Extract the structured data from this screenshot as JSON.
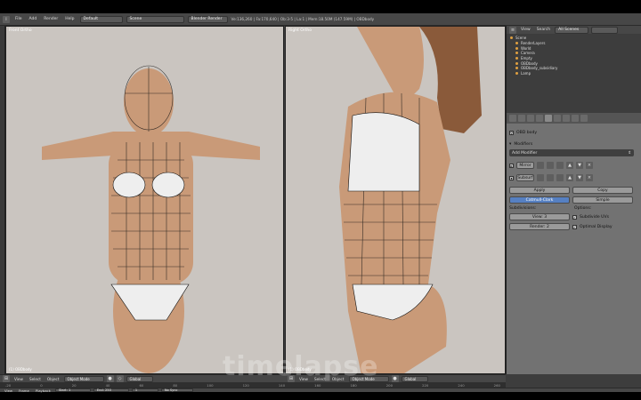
{
  "topbar": {
    "menus": [
      "File",
      "Add",
      "Render",
      "Help"
    ],
    "layout": "Default",
    "scene": "Scene",
    "engine": "Blender Render",
    "stats": "Ve:136,260 | Fa:170,640 | Ob:3-5 | La:1 | Mem:18.50M (147.59M) | OBDbody"
  },
  "viewports": {
    "front": {
      "label": "Front Ortho",
      "footer": "(1) OBDbody"
    },
    "right": {
      "label": "Right Ortho",
      "footer": "(1) OBDbody"
    }
  },
  "view_header": {
    "menus": [
      "View",
      "Select",
      "Object"
    ],
    "mode": "Object Mode",
    "orient": "Global"
  },
  "outliner": {
    "view": "View",
    "search": "Search",
    "filter": "All Scenes",
    "items": [
      "Scene",
      "RenderLayers",
      "World",
      "Camera",
      "Empty",
      "OBDbody",
      "OBDbody_subsidiary",
      "Lamp"
    ]
  },
  "properties": {
    "object_name": "OBD body",
    "section": "Modifiers",
    "add_modifier": "Add Modifier",
    "mod1": "Mirror",
    "mod2": "Subsurf",
    "apply": "Apply",
    "copy": "Copy",
    "type_cc": "Catmull-Clark",
    "type_simple": "Simple",
    "subdiv_label": "Subdivisions:",
    "options_label": "Options:",
    "view_label": "View: 3",
    "render_label": "Render: 2",
    "opt1": "Subdivide UVs",
    "opt2": "Optimal Display"
  },
  "timeline": {
    "ticks": [
      "-20",
      "0",
      "20",
      "40",
      "60",
      "80",
      "100",
      "120",
      "140",
      "160",
      "180",
      "200",
      "220",
      "240",
      "260"
    ],
    "menus": [
      "View",
      "Frame",
      "Playback"
    ],
    "start": "Start: 1",
    "end": "End: 250",
    "frame": "1",
    "sync": "No Sync"
  },
  "watermark": "timelapse"
}
